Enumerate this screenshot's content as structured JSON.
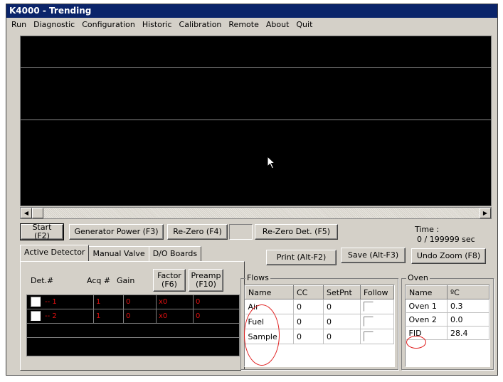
{
  "window": {
    "title": "K4000 - Trending"
  },
  "menu": [
    "Run",
    "Diagnostic",
    "Configuration",
    "Historic",
    "Calibration",
    "Remote",
    "About",
    "Quit"
  ],
  "toolbar": {
    "start": "Start (F2)",
    "generator_power": "Generator Power (F3)",
    "re_zero": "Re-Zero (F4)",
    "re_zero_det": "Re-Zero Det. (F5)",
    "print": "Print (Alt-F2)",
    "save": "Save (Alt-F3)",
    "undo_zoom": "Undo Zoom (F8)"
  },
  "time": {
    "label": "Time :",
    "value": "0 / 199999 sec"
  },
  "tabs": [
    "Active Detector",
    "Manual Valve",
    "D/O Boards"
  ],
  "detector": {
    "headers": {
      "det": "Det.#",
      "acq": "Acq #",
      "gain": "Gain"
    },
    "factor_btn": "Factor (F6)",
    "preamp_btn": "Preamp (F10)",
    "rows": [
      {
        "name": "-- 1",
        "acq": "1",
        "gain": "0",
        "factor": "x0",
        "preamp": "0"
      },
      {
        "name": "-- 2",
        "acq": "1",
        "gain": "0",
        "factor": "x0",
        "preamp": "0"
      }
    ]
  },
  "flows": {
    "title": "Flows",
    "headers": [
      "Name",
      "CC",
      "SetPnt",
      "Follow"
    ],
    "rows": [
      {
        "name": "Air",
        "cc": "0",
        "setpnt": "0"
      },
      {
        "name": "Fuel",
        "cc": "0",
        "setpnt": "0"
      },
      {
        "name": "Sample",
        "cc": "0",
        "setpnt": "0"
      }
    ]
  },
  "oven": {
    "title": "Oven",
    "headers": [
      "Name",
      "ºC"
    ],
    "rows": [
      {
        "name": "Oven 1",
        "value": "0.3"
      },
      {
        "name": "Oven 2",
        "value": "0.0"
      },
      {
        "name": "FID",
        "value": "28.4"
      }
    ]
  },
  "colors": {
    "titlebar": "#0a246a",
    "plot_bg": "#000000",
    "detector_text": "#e01010",
    "annotation": "#e02020"
  }
}
